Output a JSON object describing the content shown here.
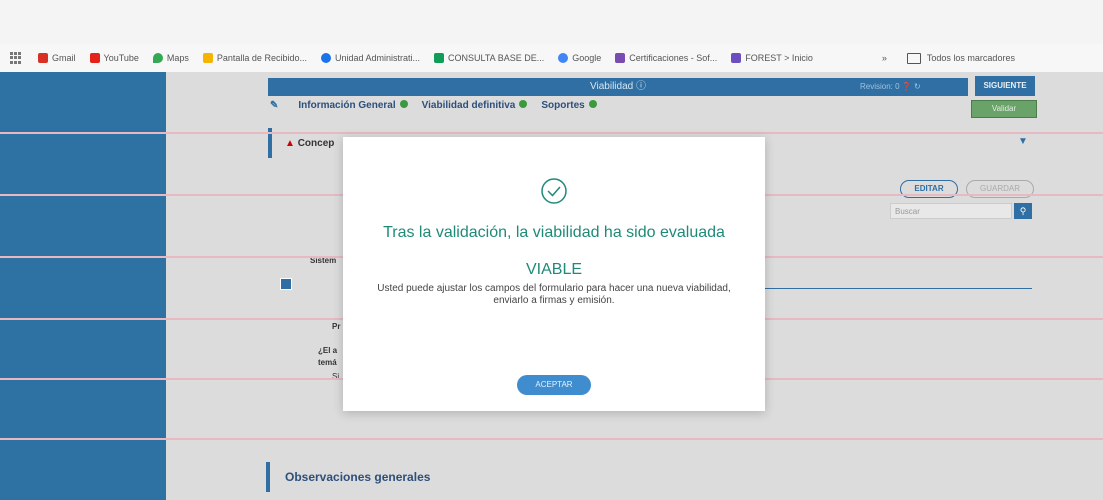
{
  "bookmarks": {
    "items": [
      {
        "label": "Gmail",
        "color": "#d93025"
      },
      {
        "label": "YouTube",
        "color": "#e62117"
      },
      {
        "label": "Maps",
        "color": "#34a853"
      },
      {
        "label": "Pantalla de Recibido...",
        "color": "#f4b400"
      },
      {
        "label": "Unidad Administrati...",
        "color": "#1a73e8"
      },
      {
        "label": "CONSULTA BASE DE...",
        "color": "#0f9d58"
      },
      {
        "label": "Google",
        "color": "#4285f4"
      },
      {
        "label": "Certificaciones - Sof...",
        "color": "#7a4bb0"
      },
      {
        "label": "FOREST > Inicio",
        "color": "#6c4fbf"
      }
    ],
    "more": "»",
    "all_bookmarks": "Todos los marcadores"
  },
  "header": {
    "title": "Viabilidad",
    "right_text": "Revision: 0",
    "next_button": "SIGUIENTE",
    "validate_button": "Validar"
  },
  "tabs": [
    {
      "label": "Información General"
    },
    {
      "label": "Viabilidad definitiva"
    },
    {
      "label": "Soportes"
    }
  ],
  "section": {
    "title": "Concep",
    "edit_button": "EDITAR",
    "save_button": "GUARDAR",
    "search_placeholder": "Buscar"
  },
  "background_text": {
    "sistem": "Sistem",
    "pr": "Pr",
    "question": "¿El a",
    "question2": "temá",
    "answer": "Si"
  },
  "observaciones": "Observaciones generales",
  "modal": {
    "title": "Tras la validación, la viabilidad ha sido evaluada",
    "result": "VIABLE",
    "description": "Usted puede ajustar los campos del formulario para hacer una nueva viabilidad, enviarlo a firmas y emisión.",
    "accept_button": "ACEPTAR"
  },
  "colors": {
    "accent": "#2f6fa3",
    "success": "#1f8a78"
  }
}
